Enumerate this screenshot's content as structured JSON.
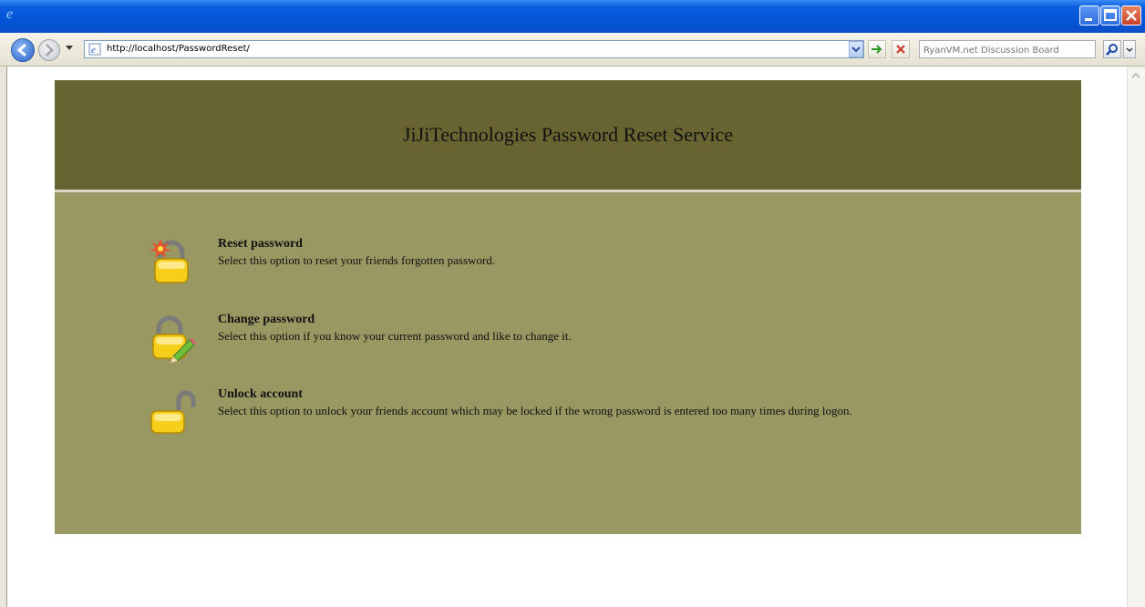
{
  "browser": {
    "address_url": "http://localhost/PasswordReset/",
    "search_placeholder": "RyanVM.net Discussion Board"
  },
  "page": {
    "banner_title": "JiJiTechnologies Password Reset Service",
    "options": [
      {
        "title": "Reset password",
        "description": "Select this option to reset your friends forgotten password.",
        "icon": "lock-burst-icon"
      },
      {
        "title": "Change password",
        "description": "Select this option if you know your current password and like to change it.",
        "icon": "lock-pencil-icon"
      },
      {
        "title": "Unlock account",
        "description": "Select this option to unlock your friends account which may be locked if the wrong password is entered too many times during logon.",
        "icon": "unlocked-padlock-icon"
      }
    ]
  },
  "colors": {
    "banner": "#676432",
    "panel": "#999862",
    "titlebar": "#0454d8"
  }
}
